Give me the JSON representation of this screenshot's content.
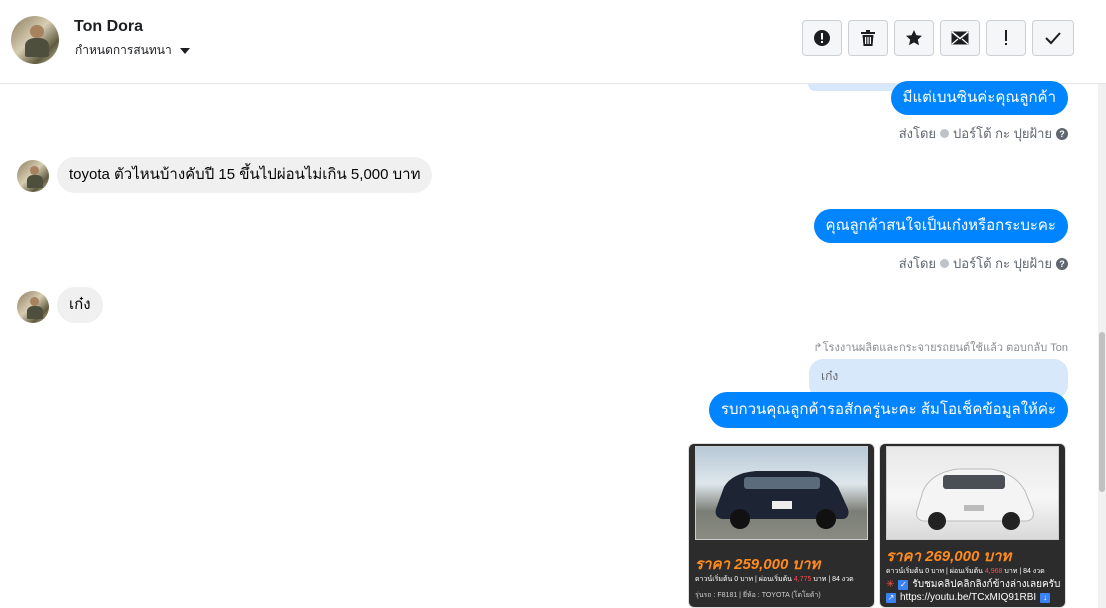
{
  "header": {
    "name": "Ton Dora",
    "subtitle": "กำหนดการสนทนา",
    "actions": [
      {
        "icon": "report-icon"
      },
      {
        "icon": "trash-icon"
      },
      {
        "icon": "star-icon"
      },
      {
        "icon": "envelope-icon"
      },
      {
        "icon": "exclamation-icon"
      },
      {
        "icon": "checkmark-icon"
      }
    ]
  },
  "messages": {
    "m1": "มีแต่เบนซินค่ะคุณลูกค้า",
    "m1_sent_prefix": "ส่งโดย",
    "m1_sender": "ปอร์โต้ กะ ปุยฝ้าย",
    "m2": "toyota ตัวไหนบ้างคับปี 15 ขึ้นไปผ่อนไม่เกิน 5,000 บาท",
    "m3": "คุณลูกค้าสนใจเป็นเก๋งหรือกระบะคะ",
    "m3_sent_prefix": "ส่งโดย",
    "m3_sender": "ปอร์โต้ กะ ปุยฝ้าย",
    "m4": "เก๋ง",
    "reply_note": "โรงงานผลิตและกระจายรถยนต์ใช้แล้ว ตอบกลับ Ton",
    "quoted": "เก๋ง",
    "m5": "รบกวนคุณลูกค้ารอสักครู่นะคะ ส้มโอเช็คข้อมูลให้ค่ะ"
  },
  "cards": [
    {
      "price": "ราคา 259,000 บาท",
      "detail_a": "ดาวน์เริ่มต้น 0 บาท | ผ่อนเริ่มต้น ",
      "detail_red": "4,775",
      "detail_b": " บาท | 84 งวด",
      "line1": "รุ่นรถ : F8181 | ยี่ห้อ : TOYOTA (โตโยต้า)",
      "car_color": "#1d2433"
    },
    {
      "price": "ราคา 269,000 บาท",
      "detail_a": "ดาวน์เริ่มต้น 0 บาท | ผ่อนเริ่มต้น ",
      "detail_red": "4,968",
      "detail_b": " บาท | 84 งวด",
      "line1": "รับชมคลิปคลิกลิงก์ข้างล่างเลยครับ",
      "line2": "https://youtu.be/TCxMIQ91RBI",
      "car_color": "#f4f4f4"
    }
  ]
}
